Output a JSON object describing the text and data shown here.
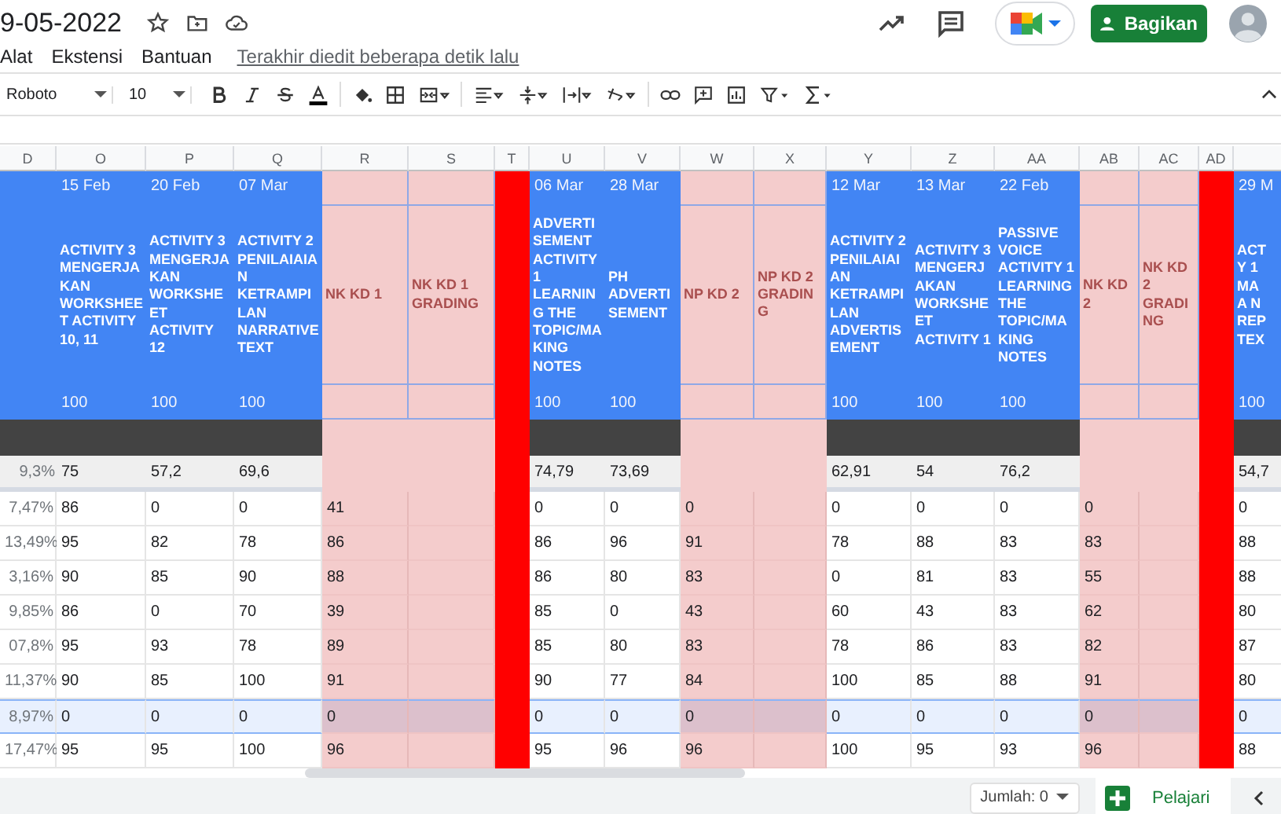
{
  "document": {
    "title": "9-05-2022",
    "last_edit": "Terakhir diedit beberapa detik lalu"
  },
  "menu": [
    "Alat",
    "Ekstensi",
    "Bantuan"
  ],
  "share_button": "Bagikan",
  "toolbar": {
    "font": "Roboto",
    "font_size": "10"
  },
  "columns": [
    {
      "letter": "D",
      "kind": "percent",
      "average": "9,3%",
      "values": [
        "7,47%",
        "13,49%",
        "3,16%",
        "9,85%",
        "07,8%",
        "11,37%",
        "8,97%",
        "17,47%"
      ]
    },
    {
      "letter": "O",
      "kind": "assignment",
      "date": "15 Feb",
      "title": "ACTIVITY 3 MENGERJAKAN WORKSHEET ACTIVITY 10, 11",
      "max": "100",
      "average": "75",
      "values": [
        "86",
        "95",
        "90",
        "86",
        "95",
        "90",
        "0",
        "95"
      ]
    },
    {
      "letter": "P",
      "kind": "assignment",
      "date": "20 Feb",
      "title": "ACTIVITY 3 MENGERJAKAN WORKSHEET ACTIVITY 12",
      "max": "100",
      "average": "57,2",
      "values": [
        "0",
        "82",
        "85",
        "0",
        "93",
        "85",
        "0",
        "95"
      ]
    },
    {
      "letter": "Q",
      "kind": "assignment",
      "date": "07 Mar",
      "title": "ACTIVITY 2 PENILAIAIAN KETRAMPILAN NARRATIVE TEXT",
      "max": "100",
      "average": "69,6",
      "values": [
        "0",
        "78",
        "90",
        "70",
        "78",
        "100",
        "0",
        "100"
      ]
    },
    {
      "letter": "R",
      "kind": "grade",
      "title": "NK KD 1",
      "values": [
        "41",
        "86",
        "88",
        "39",
        "89",
        "91",
        "0",
        "96"
      ]
    },
    {
      "letter": "S",
      "kind": "grade",
      "title": "NK KD 1 GRADING"
    },
    {
      "letter": "T",
      "kind": "separator"
    },
    {
      "letter": "U",
      "kind": "assignment",
      "date": "06 Mar",
      "title": "ADVERTISEMENT ACTIVITY 1 LEARNING THE TOPIC/MAKING NOTES",
      "max": "100",
      "average": "74,79",
      "values": [
        "0",
        "86",
        "86",
        "85",
        "85",
        "90",
        "0",
        "95"
      ]
    },
    {
      "letter": "V",
      "kind": "assignment",
      "date": "28 Mar",
      "title": "PH ADVERTISEMENT",
      "max": "100",
      "average": "73,69",
      "values": [
        "0",
        "96",
        "80",
        "0",
        "80",
        "77",
        "0",
        "96"
      ]
    },
    {
      "letter": "W",
      "kind": "grade",
      "title": "NP KD 2",
      "values": [
        "0",
        "91",
        "83",
        "43",
        "83",
        "84",
        "0",
        "96"
      ]
    },
    {
      "letter": "X",
      "kind": "grade",
      "title": "NP KD 2 GRADING"
    },
    {
      "letter": "Y",
      "kind": "assignment",
      "date": "12 Mar",
      "title": "ACTIVITY 2 PENILAIAIAN KETRAMPILAN ADVERTISEMENT",
      "max": "100",
      "average": "62,91",
      "values": [
        "0",
        "78",
        "0",
        "60",
        "78",
        "100",
        "0",
        "100"
      ]
    },
    {
      "letter": "Z",
      "kind": "assignment",
      "date": "13 Mar",
      "title": "ACTIVITY 3 MENGERJAKAN WORKSHEET ACTIVITY 1",
      "max": "100",
      "average": "54",
      "values": [
        "0",
        "88",
        "81",
        "43",
        "86",
        "85",
        "0",
        "95"
      ]
    },
    {
      "letter": "AA",
      "kind": "assignment",
      "date": "22 Feb",
      "title": "PASSIVE VOICE ACTIVITY 1 LEARNING THE TOPIC/MAKING NOTES",
      "max": "100",
      "average": "76,2",
      "values": [
        "0",
        "83",
        "83",
        "83",
        "83",
        "88",
        "0",
        "93"
      ]
    },
    {
      "letter": "AB",
      "kind": "grade",
      "title": "NK KD 2",
      "values": [
        "0",
        "83",
        "55",
        "62",
        "82",
        "91",
        "0",
        "96"
      ]
    },
    {
      "letter": "AC",
      "kind": "grade",
      "title": "NK KD 2 GRADING"
    },
    {
      "letter": "AD",
      "kind": "separator"
    },
    {
      "kind": "assignment",
      "date": "29 M",
      "title": "ACT\nY 1\nMA\nA N\nREP\nTEX",
      "max": "100",
      "average": "54,7",
      "values": [
        "0",
        "88",
        "88",
        "80",
        "87",
        "80",
        "0",
        "88"
      ]
    }
  ],
  "rows": [
    {
      "selected": false
    },
    {
      "selected": false
    },
    {
      "selected": false
    },
    {
      "selected": false
    },
    {
      "selected": false
    },
    {
      "selected": false
    },
    {
      "selected": true
    },
    {
      "selected": false
    }
  ],
  "status": {
    "sum": "Jumlah: 0",
    "explore": "Pelajari"
  }
}
